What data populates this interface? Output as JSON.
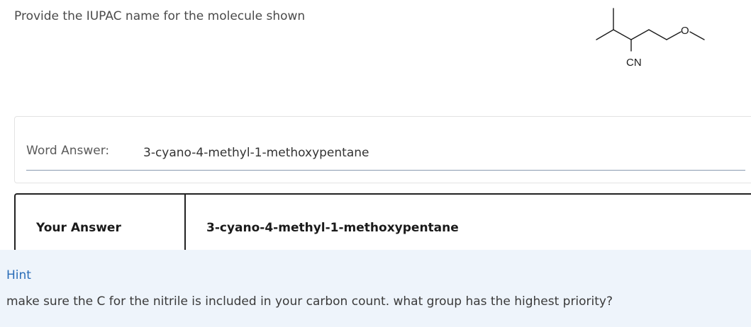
{
  "question": {
    "prompt": "Provide the IUPAC name for the molecule shown",
    "structure": {
      "nitrile_label": "CN",
      "oxygen_label": "O"
    }
  },
  "word_answer": {
    "label": "Word Answer:",
    "value": "3-cyano-4-methyl-1-methoxypentane"
  },
  "answer_table": {
    "label": "Your Answer",
    "value": "3-cyano-4-methyl-1-methoxypentane"
  },
  "hint": {
    "title": "Hint",
    "text": "make sure the C for the nitrile is included in your carbon count. what group has the highest priority?"
  },
  "colors": {
    "hint_background": "#eef4fb",
    "hint_title": "#2a6db8",
    "table_border": "#222222"
  }
}
